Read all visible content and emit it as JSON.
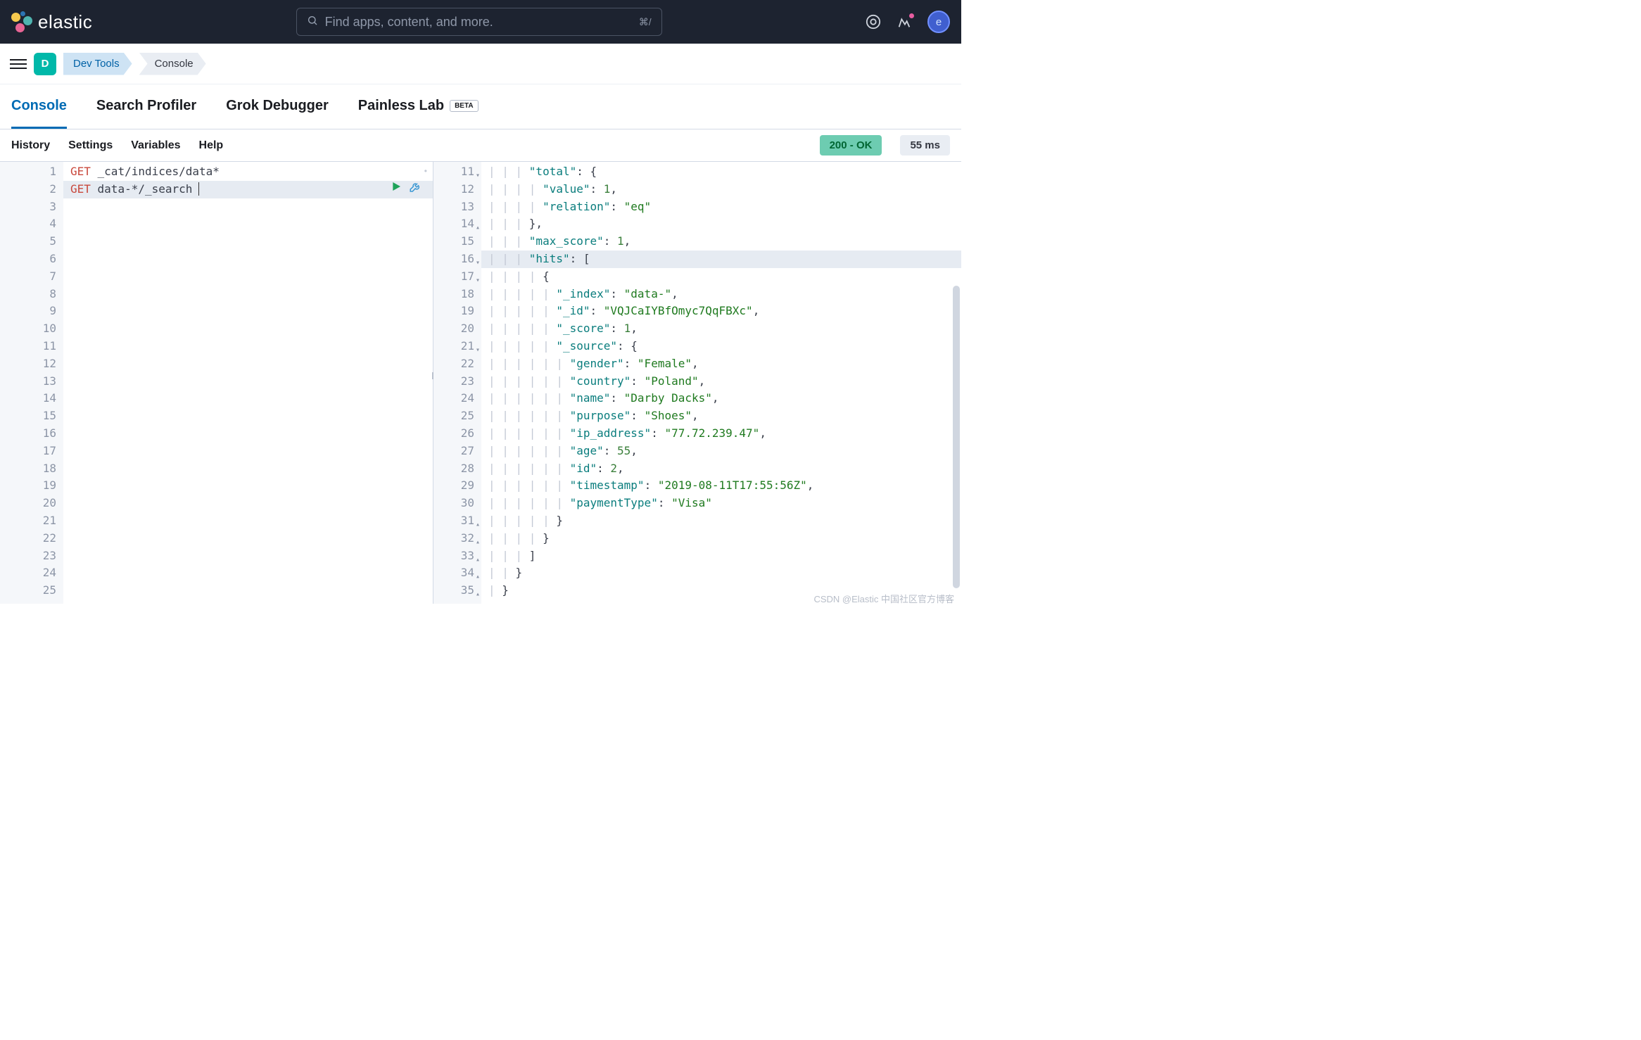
{
  "header": {
    "brand": "elastic",
    "search_placeholder": "Find apps, content, and more.",
    "search_kbd": "⌘/",
    "avatar_letter": "e"
  },
  "breadcrumb": {
    "badge": "D",
    "items": [
      "Dev Tools",
      "Console"
    ]
  },
  "tabs": [
    {
      "label": "Console",
      "active": true
    },
    {
      "label": "Search Profiler",
      "active": false
    },
    {
      "label": "Grok Debugger",
      "active": false
    },
    {
      "label": "Painless Lab",
      "active": false,
      "beta": "BETA"
    }
  ],
  "toolbar": {
    "links": [
      "History",
      "Settings",
      "Variables",
      "Help"
    ],
    "status": "200 - OK",
    "time": "55 ms"
  },
  "editor_left": {
    "line_start": 1,
    "line_end": 25,
    "rows": [
      {
        "n": 1,
        "tokens": [
          {
            "t": "GET",
            "c": "kw"
          },
          {
            "t": " _cat/indices/data*",
            "c": "punc"
          }
        ],
        "dot": true
      },
      {
        "n": 2,
        "tokens": [
          {
            "t": "GET",
            "c": "kw"
          },
          {
            "t": " data-*/_search",
            "c": "punc"
          }
        ],
        "actions": true,
        "highlight": true,
        "cursor": true
      }
    ]
  },
  "editor_right": {
    "lines": [
      {
        "n": 11,
        "fold": "▾",
        "indent": 3,
        "tokens": [
          {
            "t": "\"total\"",
            "c": "key"
          },
          {
            "t": ": {",
            "c": "punc"
          }
        ]
      },
      {
        "n": 12,
        "indent": 4,
        "tokens": [
          {
            "t": "\"value\"",
            "c": "key"
          },
          {
            "t": ": ",
            "c": "punc"
          },
          {
            "t": "1",
            "c": "num"
          },
          {
            "t": ",",
            "c": "punc"
          }
        ]
      },
      {
        "n": 13,
        "indent": 4,
        "tokens": [
          {
            "t": "\"relation\"",
            "c": "key"
          },
          {
            "t": ": ",
            "c": "punc"
          },
          {
            "t": "\"eq\"",
            "c": "str"
          }
        ]
      },
      {
        "n": 14,
        "fold": "▴",
        "indent": 3,
        "tokens": [
          {
            "t": "},",
            "c": "punc"
          }
        ]
      },
      {
        "n": 15,
        "indent": 3,
        "tokens": [
          {
            "t": "\"max_score\"",
            "c": "key"
          },
          {
            "t": ": ",
            "c": "punc"
          },
          {
            "t": "1",
            "c": "num"
          },
          {
            "t": ",",
            "c": "punc"
          }
        ]
      },
      {
        "n": 16,
        "fold": "▾",
        "indent": 3,
        "highlight": true,
        "tokens": [
          {
            "t": "\"hits\"",
            "c": "key"
          },
          {
            "t": ": [",
            "c": "punc"
          }
        ]
      },
      {
        "n": 17,
        "fold": "▾",
        "indent": 4,
        "tokens": [
          {
            "t": "{",
            "c": "punc"
          }
        ]
      },
      {
        "n": 18,
        "indent": 5,
        "tokens": [
          {
            "t": "\"_index\"",
            "c": "key"
          },
          {
            "t": ": ",
            "c": "punc"
          },
          {
            "t": "\"data-\"",
            "c": "str"
          },
          {
            "t": ",",
            "c": "punc"
          }
        ]
      },
      {
        "n": 19,
        "indent": 5,
        "tokens": [
          {
            "t": "\"_id\"",
            "c": "key"
          },
          {
            "t": ": ",
            "c": "punc"
          },
          {
            "t": "\"VQJCaIYBfOmyc7QqFBXc\"",
            "c": "str"
          },
          {
            "t": ",",
            "c": "punc"
          }
        ]
      },
      {
        "n": 20,
        "indent": 5,
        "tokens": [
          {
            "t": "\"_score\"",
            "c": "key"
          },
          {
            "t": ": ",
            "c": "punc"
          },
          {
            "t": "1",
            "c": "num"
          },
          {
            "t": ",",
            "c": "punc"
          }
        ]
      },
      {
        "n": 21,
        "fold": "▾",
        "indent": 5,
        "tokens": [
          {
            "t": "\"_source\"",
            "c": "key"
          },
          {
            "t": ": {",
            "c": "punc"
          }
        ]
      },
      {
        "n": 22,
        "indent": 6,
        "tokens": [
          {
            "t": "\"gender\"",
            "c": "key"
          },
          {
            "t": ": ",
            "c": "punc"
          },
          {
            "t": "\"Female\"",
            "c": "str"
          },
          {
            "t": ",",
            "c": "punc"
          }
        ]
      },
      {
        "n": 23,
        "indent": 6,
        "tokens": [
          {
            "t": "\"country\"",
            "c": "key"
          },
          {
            "t": ": ",
            "c": "punc"
          },
          {
            "t": "\"Poland\"",
            "c": "str"
          },
          {
            "t": ",",
            "c": "punc"
          }
        ]
      },
      {
        "n": 24,
        "indent": 6,
        "tokens": [
          {
            "t": "\"name\"",
            "c": "key"
          },
          {
            "t": ": ",
            "c": "punc"
          },
          {
            "t": "\"Darby Dacks\"",
            "c": "str"
          },
          {
            "t": ",",
            "c": "punc"
          }
        ]
      },
      {
        "n": 25,
        "indent": 6,
        "tokens": [
          {
            "t": "\"purpose\"",
            "c": "key"
          },
          {
            "t": ": ",
            "c": "punc"
          },
          {
            "t": "\"Shoes\"",
            "c": "str"
          },
          {
            "t": ",",
            "c": "punc"
          }
        ]
      },
      {
        "n": 26,
        "indent": 6,
        "tokens": [
          {
            "t": "\"ip_address\"",
            "c": "key"
          },
          {
            "t": ": ",
            "c": "punc"
          },
          {
            "t": "\"77.72.239.47\"",
            "c": "str"
          },
          {
            "t": ",",
            "c": "punc"
          }
        ]
      },
      {
        "n": 27,
        "indent": 6,
        "tokens": [
          {
            "t": "\"age\"",
            "c": "key"
          },
          {
            "t": ": ",
            "c": "punc"
          },
          {
            "t": "55",
            "c": "num"
          },
          {
            "t": ",",
            "c": "punc"
          }
        ]
      },
      {
        "n": 28,
        "indent": 6,
        "tokens": [
          {
            "t": "\"id\"",
            "c": "key"
          },
          {
            "t": ": ",
            "c": "punc"
          },
          {
            "t": "2",
            "c": "num"
          },
          {
            "t": ",",
            "c": "punc"
          }
        ]
      },
      {
        "n": 29,
        "indent": 6,
        "tokens": [
          {
            "t": "\"timestamp\"",
            "c": "key"
          },
          {
            "t": ": ",
            "c": "punc"
          },
          {
            "t": "\"2019-08-11T17:55:56Z\"",
            "c": "str"
          },
          {
            "t": ",",
            "c": "punc"
          }
        ]
      },
      {
        "n": 30,
        "indent": 6,
        "tokens": [
          {
            "t": "\"paymentType\"",
            "c": "key"
          },
          {
            "t": ": ",
            "c": "punc"
          },
          {
            "t": "\"Visa\"",
            "c": "str"
          }
        ]
      },
      {
        "n": 31,
        "fold": "▴",
        "indent": 5,
        "tokens": [
          {
            "t": "}",
            "c": "punc"
          }
        ]
      },
      {
        "n": 32,
        "fold": "▴",
        "indent": 4,
        "tokens": [
          {
            "t": "}",
            "c": "punc"
          }
        ]
      },
      {
        "n": 33,
        "fold": "▴",
        "indent": 3,
        "tokens": [
          {
            "t": "]",
            "c": "punc"
          }
        ]
      },
      {
        "n": 34,
        "fold": "▴",
        "indent": 2,
        "tokens": [
          {
            "t": "}",
            "c": "punc"
          }
        ]
      },
      {
        "n": 35,
        "fold": "▴",
        "indent": 1,
        "tokens": [
          {
            "t": "}",
            "c": "punc"
          }
        ]
      }
    ]
  },
  "watermark": "CSDN @Elastic 中国社区官方博客"
}
